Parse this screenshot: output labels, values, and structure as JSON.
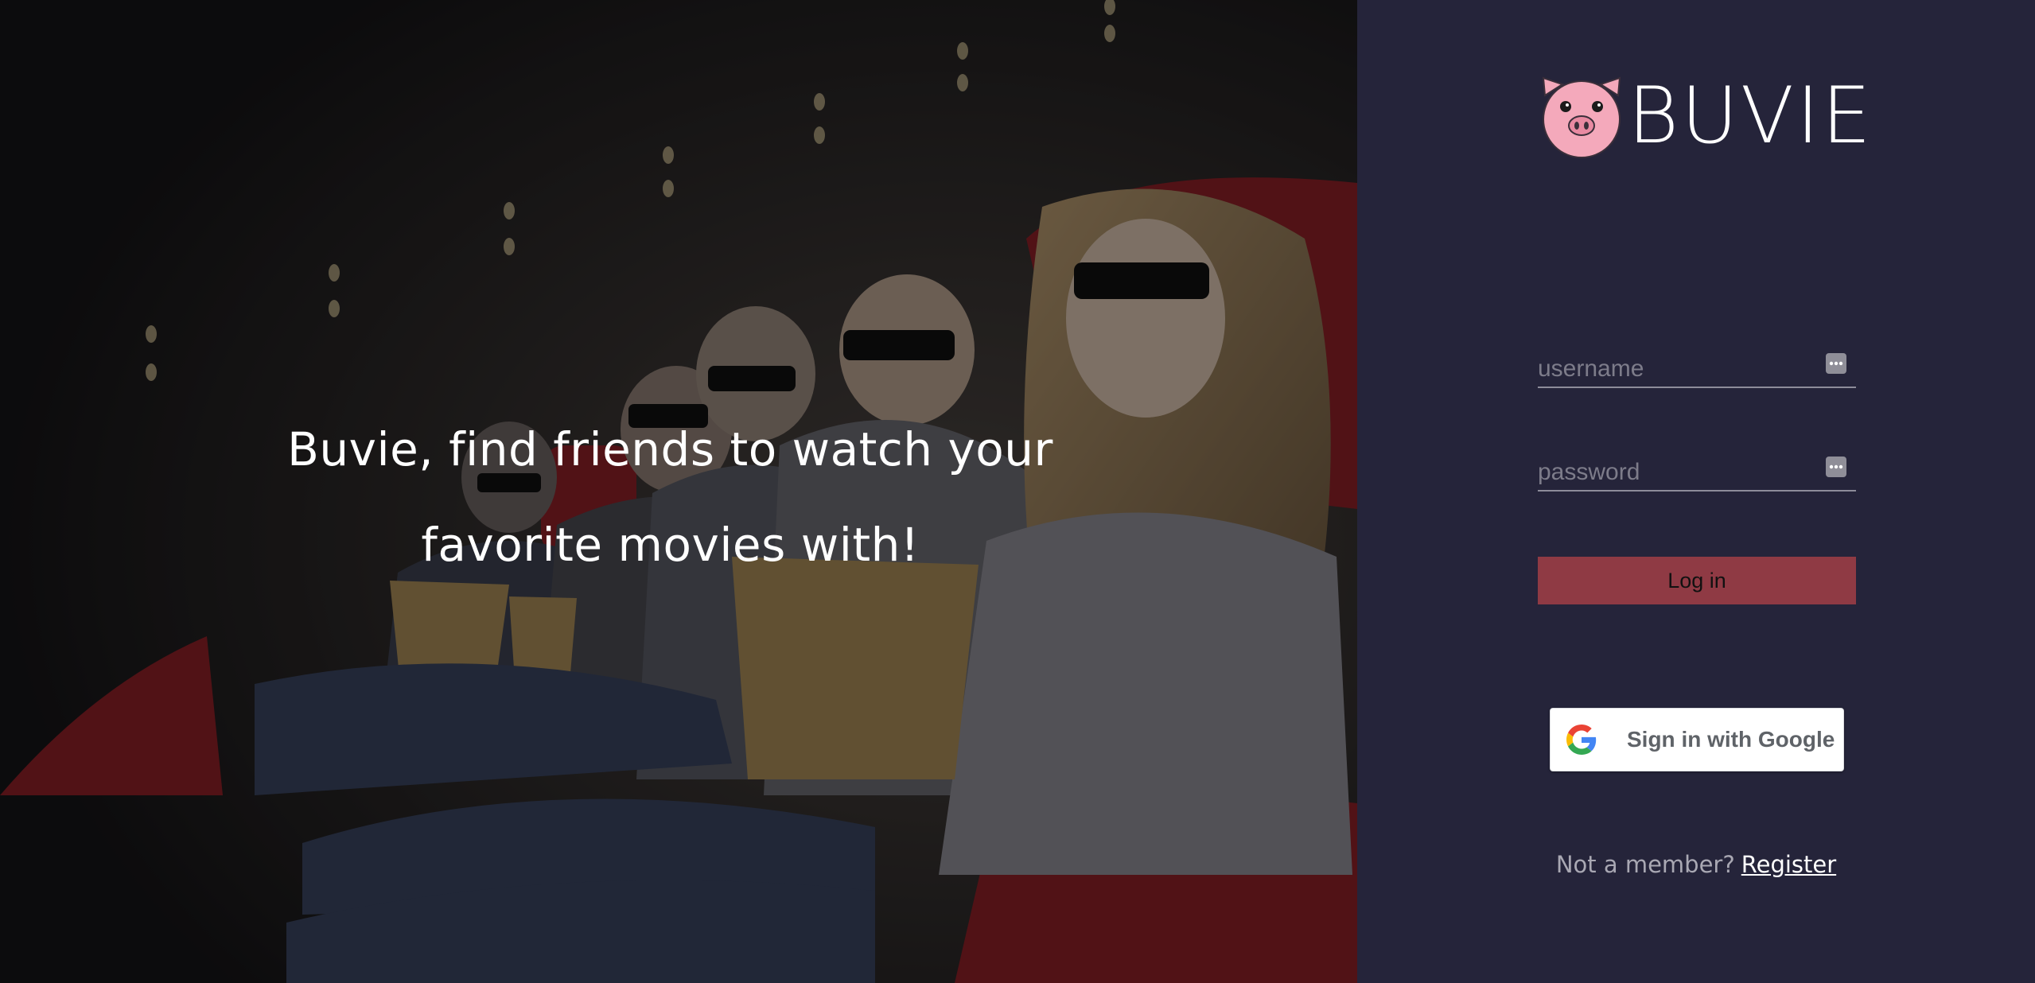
{
  "app": {
    "name": "BUVIE"
  },
  "hero": {
    "tagline": "Buvie, find friends to watch your favorite movies with!",
    "image": "cinema-audience-3d-glasses"
  },
  "login": {
    "username_placeholder": "username",
    "password_placeholder": "password",
    "login_label": "Log in",
    "google_label": "Sign in with Google",
    "register_prompt": "Not a member?",
    "register_link": "Register"
  },
  "icons": {
    "logo": "pig-icon",
    "field_autofill": "password-manager-key-icon",
    "google": "google-g-icon"
  },
  "colors": {
    "panel_bg": "#25243a",
    "login_button": "#8f3a44",
    "pig": "#f4a9bb",
    "text": "#ffffff"
  }
}
